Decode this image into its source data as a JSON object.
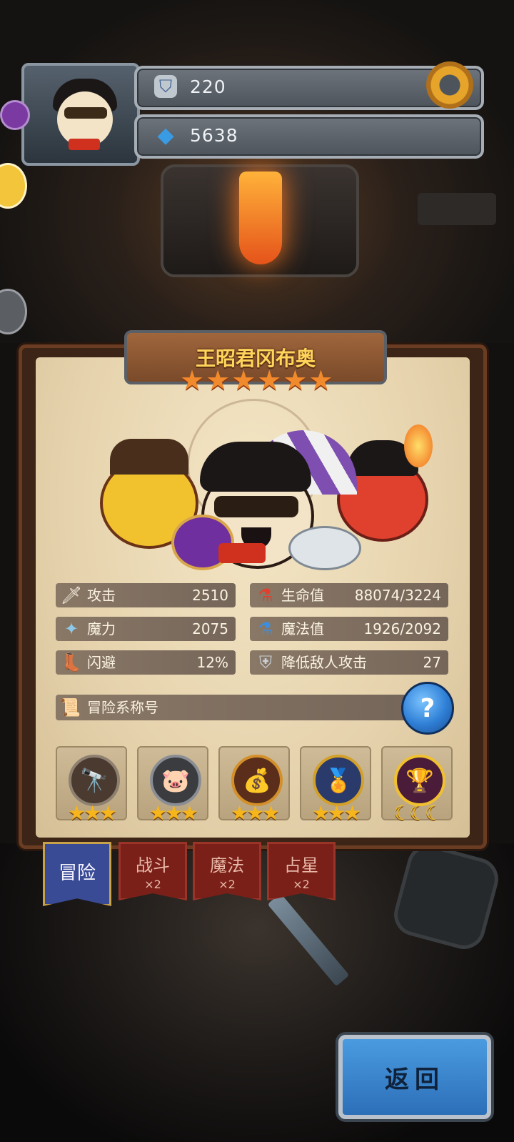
{
  "header": {
    "trophy_value": "220",
    "gem_value": "5638",
    "icons": {
      "trophy": "trophy-icon",
      "gem": "gem-icon",
      "settings": "gear-icon"
    }
  },
  "hero": {
    "name": "王昭君冈布奥",
    "stars": 6
  },
  "stats": [
    {
      "icon": "sword-icon",
      "glyph": "🗡",
      "label": "攻击",
      "value": "2510"
    },
    {
      "icon": "health-potion-icon",
      "glyph": "⚗",
      "label": "生命值",
      "value": "88074/3224"
    },
    {
      "icon": "magic-wand-icon",
      "glyph": "✦",
      "label": "魔力",
      "value": "2075"
    },
    {
      "icon": "mana-potion-icon",
      "glyph": "⚗",
      "label": "魔法值",
      "value": "1926/2092"
    },
    {
      "icon": "boot-icon",
      "glyph": "👢",
      "label": "闪避",
      "value": "12%"
    },
    {
      "icon": "shield-icon",
      "glyph": "⛨",
      "label": "降低敌人攻击",
      "value": "27"
    }
  ],
  "adventure": {
    "label": "冒险系称号",
    "icon": "scroll-icon",
    "help": "?"
  },
  "badges": [
    {
      "icon": "telescope-badge-icon",
      "glyph": "🔭",
      "stars": "★★★"
    },
    {
      "icon": "pig-badge-icon",
      "glyph": "🐷",
      "stars": "★★★"
    },
    {
      "icon": "treasure-badge-icon",
      "glyph": "💰",
      "stars": "★★★"
    },
    {
      "icon": "crest-badge-icon",
      "glyph": "🏅",
      "stars": "★★★"
    },
    {
      "icon": "crown-trophy-badge-icon",
      "glyph": "🏆",
      "stars": "☾☾☾"
    }
  ],
  "tabs": [
    {
      "label": "冒险",
      "sub": "",
      "active": true
    },
    {
      "label": "战斗",
      "sub": "×2",
      "active": false
    },
    {
      "label": "魔法",
      "sub": "×2",
      "active": false
    },
    {
      "label": "占星",
      "sub": "×2",
      "active": false
    }
  ],
  "back_button": "返回",
  "colors": {
    "accent_blue": "#2f7fd6",
    "title_gold": "#ffd45a",
    "star_orange": "#f08a2c"
  }
}
